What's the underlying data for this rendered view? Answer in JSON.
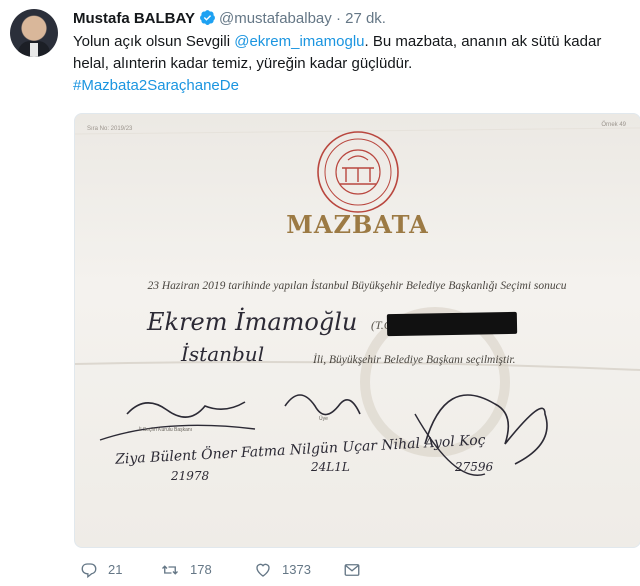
{
  "tweet": {
    "author_name": "Mustafa BALBAY",
    "author_handle": "@mustafabalbay",
    "separator": "·",
    "time": "27 dk.",
    "text": {
      "line1_pre": "Yolun açık olsun Sevgili ",
      "mention": "@ekrem_imamoglu",
      "line1_post": ". Bu mazbata, ananın ak sütü kadar",
      "line2": "helal, alınterin kadar temiz, yüreğin kadar güçlüdür.",
      "hashtag": "#Mazbata2SaraçhaneDe"
    },
    "media": {
      "title": "MAZBATA",
      "top_left_code": "Sıra No: 2019/23",
      "top_right_code": "Örnek 49",
      "line1": "23 Haziran 2019 tarihinde yapılan İstanbul Büyükşehir Belediye Başkanlığı Seçimi sonucu",
      "winner": "Ekrem İmamoğlu",
      "tc_prefix": "(T.C",
      "city": "İstanbul",
      "line2": "İli, Büyükşehir Belediye Başkanı seçilmiştir.",
      "sig_label_left": "İl Seçim Kurulu Başkanı",
      "sig_label_mid": "Üye",
      "sig_names": "Ziya Bülent Öner Fatma Nilgün Uçar Nihal Ayol Koç",
      "sig_num_1": "21978",
      "sig_num_2": "24L1L",
      "sig_num_3": "27596"
    },
    "actions": {
      "reply_count": "21",
      "retweet_count": "178",
      "like_count": "1373"
    }
  },
  "colors": {
    "link": "#1b95e0",
    "muted": "#657786",
    "verified": "#1da1f2"
  }
}
